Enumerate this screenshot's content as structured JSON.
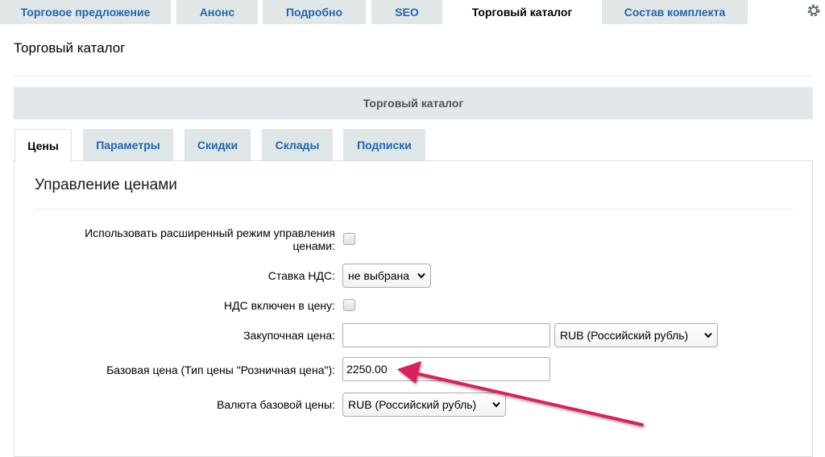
{
  "top_tabs": [
    {
      "label": "Торговое предложение"
    },
    {
      "label": "Анонс"
    },
    {
      "label": "Подробно"
    },
    {
      "label": "SEO"
    },
    {
      "label": "Торговый каталог"
    },
    {
      "label": "Состав комплекта"
    }
  ],
  "page_title": "Торговый каталог",
  "section_header": "Торговый каталог",
  "sub_tabs": [
    {
      "label": "Цены"
    },
    {
      "label": "Параметры"
    },
    {
      "label": "Скидки"
    },
    {
      "label": "Склады"
    },
    {
      "label": "Подписки"
    }
  ],
  "panel_title": "Управление ценами",
  "form": {
    "extended_mode_label_line1": "Использовать расширенный режим управления",
    "extended_mode_label_line2": "ценами:",
    "vat_rate_label": "Ставка НДС:",
    "vat_rate_value": "не выбрана",
    "vat_included_label": "НДС включен в цену:",
    "purchase_price_label": "Закупочная цена:",
    "purchase_price_value": "",
    "purchase_currency_value": "RUB (Российский рубль)",
    "base_price_label": "Базовая цена (Тип цены \"Розничная цена\"):",
    "base_price_value": "2250.00",
    "base_currency_label": "Валюта базовой цены:",
    "base_currency_value": "RUB (Российский рубль)"
  },
  "colors": {
    "link_blue": "#2067b0",
    "tab_bg": "#e1e6e7",
    "annotation_arrow": "#d9225a"
  }
}
